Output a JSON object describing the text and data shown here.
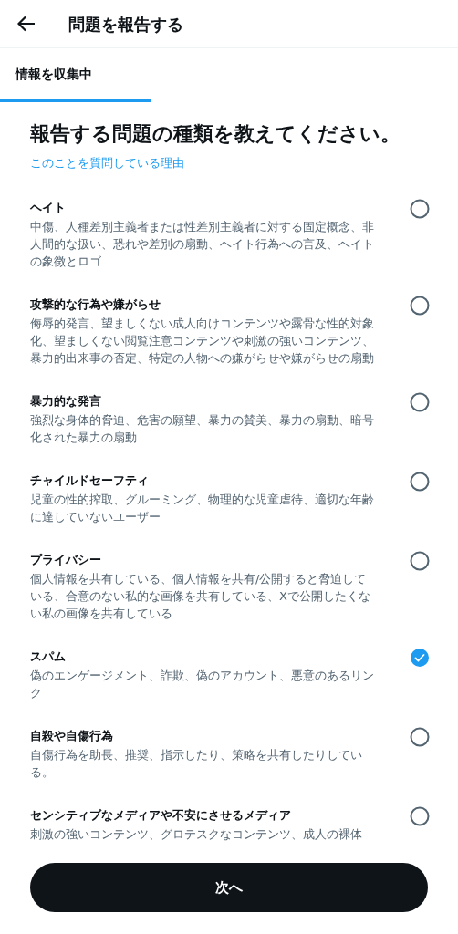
{
  "header": {
    "title": "問題を報告する"
  },
  "step": {
    "label": "情報を収集中",
    "level": 0.33
  },
  "heading": "報告する問題の種類を教えてください。",
  "why_link": "このことを質問している理由",
  "options": [
    {
      "title": "ヘイト",
      "description": "中傷、人種差別主義者または性差別主義者に対する固定概念、非人間的な扱い、恐れや差別の扇動、ヘイト行為への言及、ヘイトの象徴とロゴ",
      "selected": false
    },
    {
      "title": "攻撃的な行為や嫌がらせ",
      "description": "侮辱的発言、望ましくない成人向けコンテンツや露骨な性的対象化、望ましくない閲覧注意コンテンツや刺激の強いコンテンツ、暴力的出来事の否定、特定の人物への嫌がらせや嫌がらせの扇動",
      "selected": false
    },
    {
      "title": "暴力的な発言",
      "description": "強烈な身体的脅迫、危害の願望、暴力の賛美、暴力の扇動、暗号化された暴力の扇動",
      "selected": false
    },
    {
      "title": "チャイルドセーフティ",
      "description": "児童の性的搾取、グルーミング、物理的な児童虐待、適切な年齢に達していないユーザー",
      "selected": false
    },
    {
      "title": "プライバシー",
      "description": "個人情報を共有している、個人情報を共有/公開すると脅迫している、合意のない私的な画像を共有している、Xで公開したくない私の画像を共有している",
      "selected": false
    },
    {
      "title": "スパム",
      "description": "偽のエンゲージメント、詐欺、偽のアカウント、悪意のあるリンク",
      "selected": true
    },
    {
      "title": "自殺や自傷行為",
      "description": "自傷行為を助長、推奨、指示したり、策略を共有したりしている。",
      "selected": false
    },
    {
      "title": "センシティブなメディアや不安にさせるメディア",
      "description": "刺激の強いコンテンツ、グロテスクなコンテンツ、成人の裸体",
      "selected": false
    }
  ],
  "next_button": "次へ"
}
